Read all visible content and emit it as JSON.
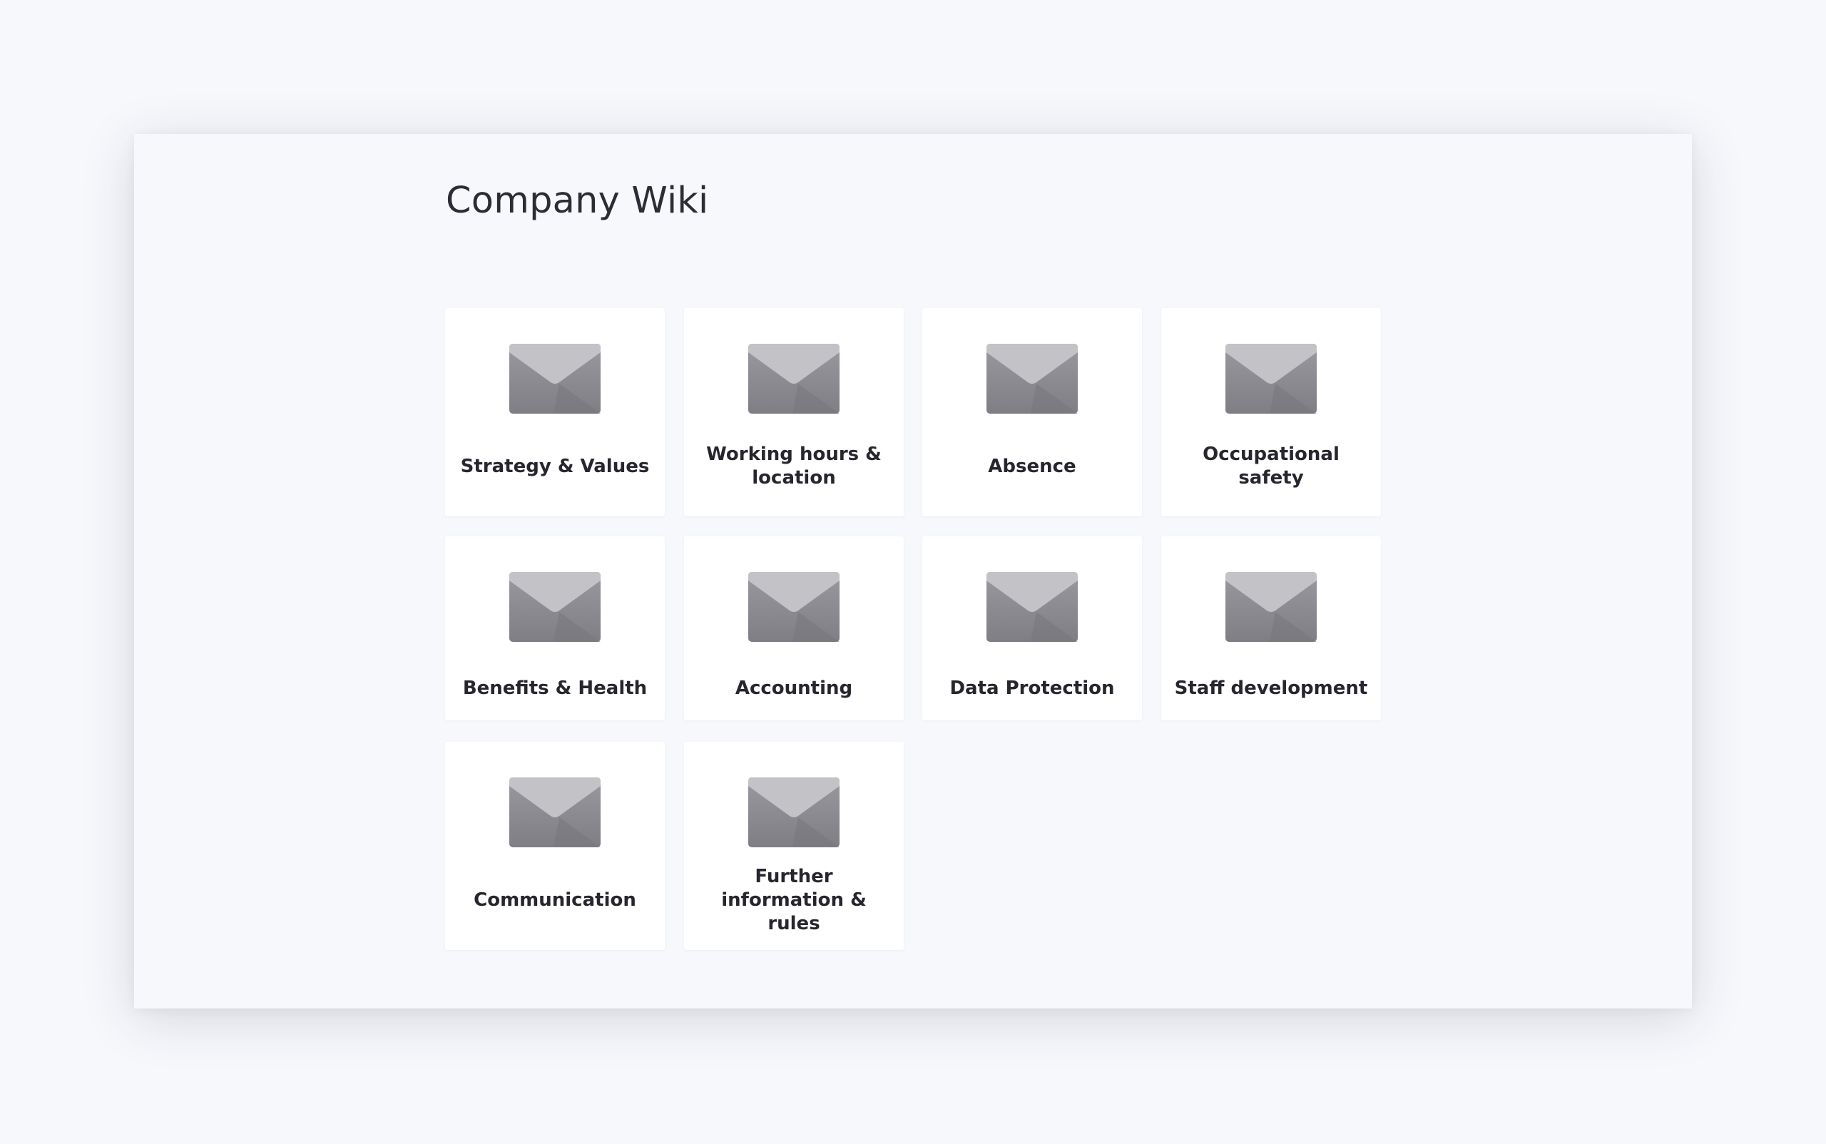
{
  "page": {
    "title": "Company Wiki"
  },
  "tiles": [
    {
      "label": "Strategy & Values",
      "icon": "envelope-icon"
    },
    {
      "label": "Working hours & location",
      "icon": "envelope-icon"
    },
    {
      "label": "Absence",
      "icon": "envelope-icon"
    },
    {
      "label": "Occupational safety",
      "icon": "envelope-icon"
    },
    {
      "label": "Benefits & Health",
      "icon": "envelope-icon"
    },
    {
      "label": "Accounting",
      "icon": "envelope-icon"
    },
    {
      "label": "Data Protection",
      "icon": "envelope-icon"
    },
    {
      "label": "Staff development",
      "icon": "envelope-icon"
    },
    {
      "label": "Communication",
      "icon": "envelope-icon"
    },
    {
      "label": "Further information & rules",
      "icon": "envelope-icon"
    }
  ],
  "colors": {
    "background": "#f7f8fc",
    "tile": "#ffffff",
    "icon_body": "#8e8d93",
    "icon_flap": "#c2c1c6",
    "text": "#26262e"
  }
}
